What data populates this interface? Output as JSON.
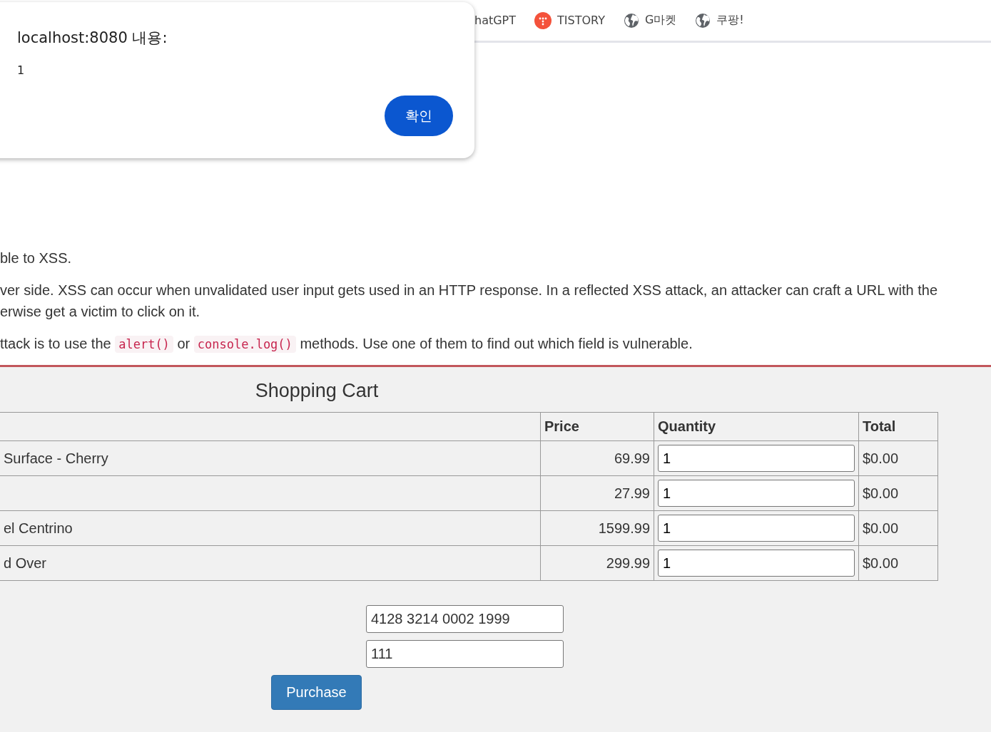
{
  "bookmarks": [
    {
      "label": "hatGPT",
      "kind": "plain"
    },
    {
      "label": "TISTORY",
      "kind": "dots"
    },
    {
      "label": "G마켓",
      "kind": "globe"
    },
    {
      "label": "쿠팡!",
      "kind": "globe"
    }
  ],
  "dialog": {
    "title": "localhost:8080 내용:",
    "message": "1",
    "button": "확인"
  },
  "paragraphs": [
    [
      {
        "text": "ble to XSS."
      }
    ],
    [
      {
        "text": "ver side. XSS can occur when unvalidated user input gets used in an HTTP response. In a reflected XSS attack, an attacker can craft a URL with the erwise get a victim to click on it."
      }
    ],
    [
      {
        "text": "ttack is to use the "
      },
      {
        "code": "alert()"
      },
      {
        "text": " or "
      },
      {
        "code": "console.log()"
      },
      {
        "text": " methods. Use one of them to find out which field is vulnerable."
      }
    ]
  ],
  "cart": {
    "title": "Shopping Cart",
    "columns": [
      "Price",
      "Quantity",
      "Total"
    ],
    "rows": [
      {
        "item": "Surface - Cherry",
        "price": "69.99",
        "quantity": "1",
        "total": "$0.00"
      },
      {
        "item": "",
        "price": "27.99",
        "quantity": "1",
        "total": "$0.00"
      },
      {
        "item": "el Centrino",
        "price": "1599.99",
        "quantity": "1",
        "total": "$0.00"
      },
      {
        "item": "d Over",
        "price": "299.99",
        "quantity": "1",
        "total": "$0.00"
      }
    ],
    "card_number": "4128 3214 0002 1999",
    "code": "111",
    "button": "Purchase"
  }
}
